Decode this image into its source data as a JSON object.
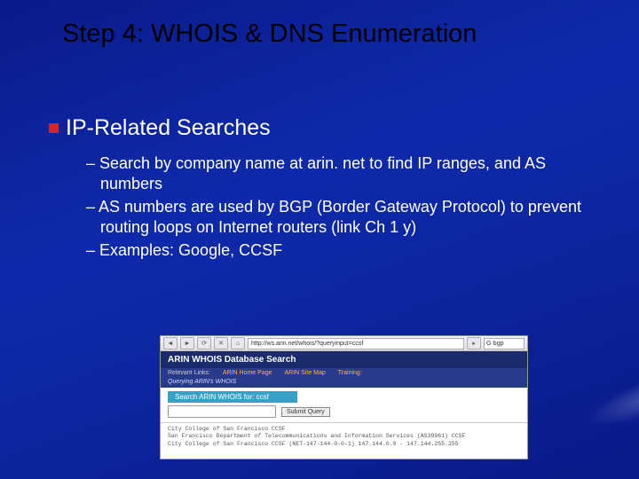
{
  "slide": {
    "title": "Step 4: WHOIS & DNS Enumeration",
    "heading": "IP-Related Searches",
    "bullets": [
      "Search by company name at arin. net to find IP ranges, and AS numbers",
      "AS numbers are used by BGP (Border Gateway Protocol) to prevent routing loops on Internet routers (link Ch 1 y)",
      "Examples: Google, CCSF"
    ]
  },
  "browser": {
    "url": "http://ws.arin.net/whois/?queryinput=ccsf",
    "search_value": "bgp",
    "search_prefix": "G"
  },
  "arin": {
    "header": "ARIN WHOIS Database Search",
    "relevant_label": "Relevant Links:",
    "link_home": "ARIN Home Page",
    "link_sitemap": "ARIN Site Map",
    "link_training": "Training:",
    "subtitle": "Querying ARIN's WHOIS",
    "search_label": "Search ARIN WHOIS for: ccsf",
    "submit": "Submit Query",
    "results_line1": "City College of San Francisco CCSF",
    "results_line2": "San Francisco Department of Telecommunications and Information Services (AS39961) CCSF",
    "results_line3": "City College of San Francisco CCSF (NET-147-144-0-0-1) 147.144.0.0 - 147.144.255.255"
  }
}
